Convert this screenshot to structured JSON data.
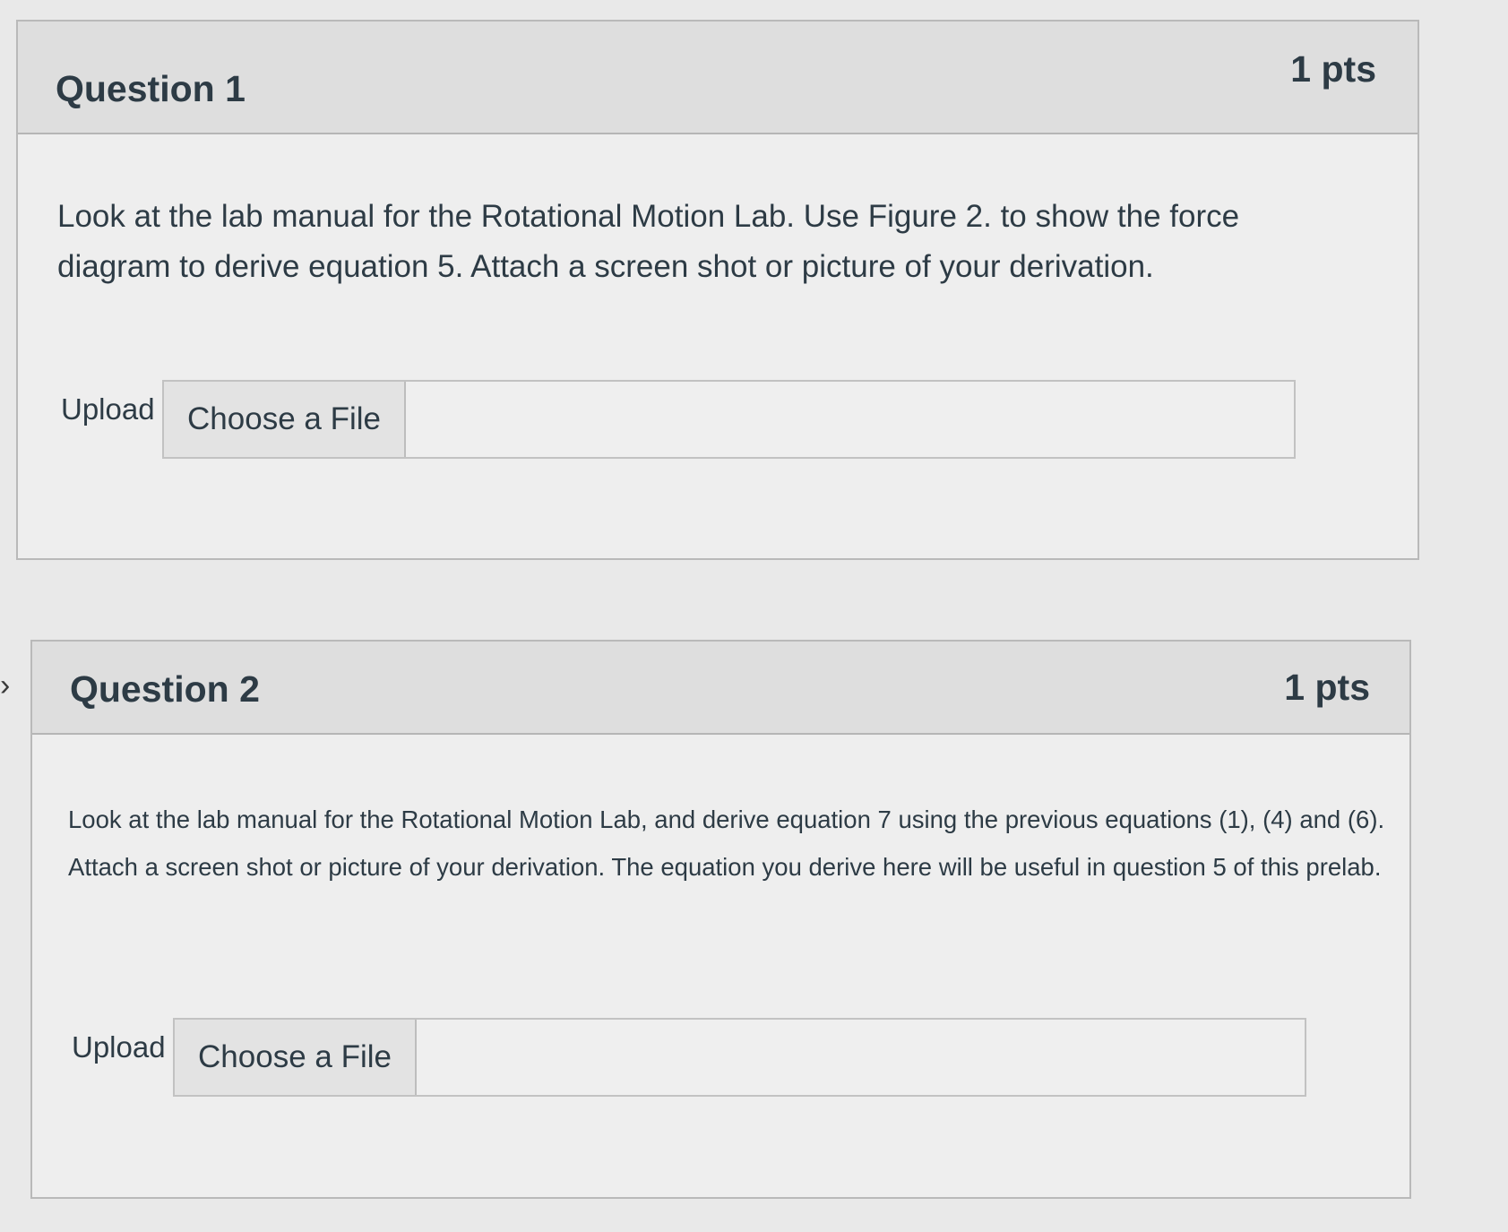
{
  "questions": [
    {
      "title": "Question 1",
      "points": "1 pts",
      "text": "Look at the lab manual for the Rotational Motion Lab. Use Figure 2. to show the force diagram to derive equation 5. Attach a screen shot or picture of your derivation.",
      "upload_label": "Upload",
      "choose_file_label": "Choose a File"
    },
    {
      "title": "Question 2",
      "points": "1 pts",
      "text": "Look at the lab manual for the Rotational Motion Lab, and derive equation 7 using the previous equations (1), (4) and (6). Attach a screen shot or picture of your derivation. The equation you derive here will be useful in question 5 of this prelab.",
      "upload_label": "Upload",
      "choose_file_label": "Choose a File"
    }
  ],
  "icons": {
    "side_chevron": "chevron-right-icon"
  }
}
